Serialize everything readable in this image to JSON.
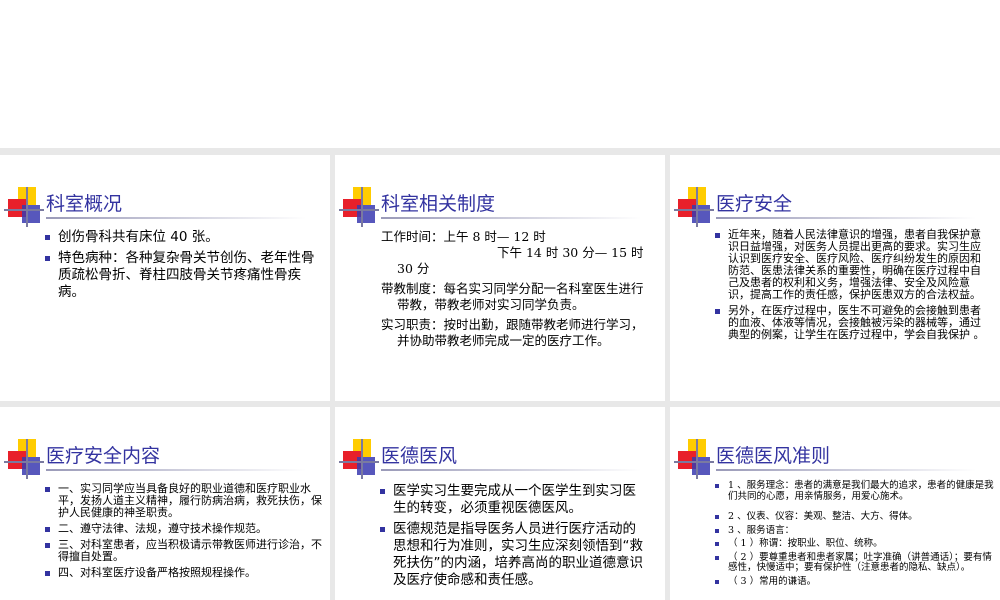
{
  "slides": [
    {
      "title": "科室概况",
      "items": [
        "创伤骨科共有床位 40 张。",
        "特色病种：各种复杂骨关节创伤、老年性骨质疏松骨折、脊柱四肢骨关节疼痛性骨疾病。"
      ]
    },
    {
      "title": "科室相关制度",
      "work_time_1": "工作时间：上午 8 时— 12 时",
      "work_time_2": "下午 14 时 30 分— 15 时",
      "work_time_3": "30 分",
      "teaching": "带教制度：每名实习同学分配一名科室医生进行带教，带教老师对实习同学负责。",
      "duty": "实习职责：按时出勤，跟随带教老师进行学习，并协助带教老师完成一定的医疗工作。"
    },
    {
      "title": "医疗安全",
      "items": [
        "近年来，随着人民法律意识的增强，患者自我保护意识日益增强，对医务人员提出更高的要求。实习生应认识到医疗安全、医疗风险、医疗纠纷发生的原因和防范、医患法律关系的重要性，明确在医疗过程中自己及患者的权利和义务，增强法律、安全及风险意识，提高工作的责任感，保护医患双方的合法权益。",
        "另外，在医疗过程中，医生不可避免的会接触到患者的血液、体液等情况，会接触被污染的器械等，通过典型的例案，让学生在医疗过程中，学会自我保护 。"
      ]
    },
    {
      "title": "医疗安全内容",
      "items": [
        "一、实习同学应当具备良好的职业道德和医疗职业水平，发扬人道主义精神，履行防病治病，救死扶伤，保护人民健康的神圣职责。",
        "二、遵守法律、法规，遵守技术操作规范。",
        "三、对科室患者，应当积极请示带教医师进行诊治，不得擅自处置。",
        "四、对科室医疗设备严格按照规程操作。"
      ]
    },
    {
      "title": "医德医风",
      "items": [
        "医学实习生要完成从一个医学生到实习医生的转变，必须重视医德医风。",
        "医德规范是指导医务人员进行医疗活动的思想和行为准则，实习生应深刻领悟到“救死扶伤”的内涵，培养高尚的职业道德意识及医疗使命感和责任感。"
      ]
    },
    {
      "title": "医德医风准则",
      "items": [
        "1 、服务理念：患者的满意是我们最大的追求，患者的健康是我们共同的心愿，用亲情服务，用爱心施术。",
        "2 、仪表、仪容：美观、整洁、大方、得体。",
        "3 、服务语言：",
        "（ 1 ）称谓：按职业、职位、统称。",
        "（ 2 ）要尊重患者和患者家属；吐字准确（讲普通话）；要有情感性，快慢适中；要有保护性（注意患者的隐私、缺点）。",
        "（ 3 ）常用的谦语。"
      ]
    }
  ]
}
